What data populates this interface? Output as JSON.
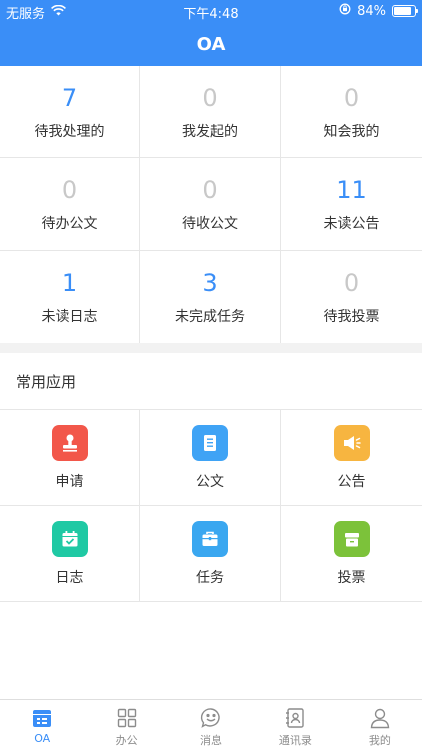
{
  "status_bar": {
    "carrier": "无服务",
    "time": "下午4:48",
    "battery": "84%",
    "battery_fraction": 0.84
  },
  "header": {
    "title": "OA"
  },
  "stats": [
    {
      "count": "7",
      "label": "待我处理的",
      "highlight": true
    },
    {
      "count": "0",
      "label": "我发起的",
      "highlight": false
    },
    {
      "count": "0",
      "label": "知会我的",
      "highlight": false
    },
    {
      "count": "0",
      "label": "待办公文",
      "highlight": false
    },
    {
      "count": "0",
      "label": "待收公文",
      "highlight": false
    },
    {
      "count": "11",
      "label": "未读公告",
      "highlight": true
    },
    {
      "count": "1",
      "label": "未读日志",
      "highlight": true
    },
    {
      "count": "3",
      "label": "未完成任务",
      "highlight": true
    },
    {
      "count": "0",
      "label": "待我投票",
      "highlight": false
    }
  ],
  "apps_section": {
    "title": "常用应用"
  },
  "apps": [
    {
      "label": "申请",
      "icon": "stamp-icon",
      "color": "#f2574a"
    },
    {
      "label": "公文",
      "icon": "document-icon",
      "color": "#3fa3f5"
    },
    {
      "label": "公告",
      "icon": "megaphone-icon",
      "color": "#f7b540"
    },
    {
      "label": "日志",
      "icon": "calendar-icon",
      "color": "#1fc9a4"
    },
    {
      "label": "任务",
      "icon": "briefcase-icon",
      "color": "#3aa7f0"
    },
    {
      "label": "投票",
      "icon": "ballot-box-icon",
      "color": "#7cc23a"
    }
  ],
  "tabs": [
    {
      "label": "OA",
      "icon": "oa-icon",
      "active": true
    },
    {
      "label": "办公",
      "icon": "grid-icon",
      "active": false
    },
    {
      "label": "消息",
      "icon": "message-icon",
      "active": false
    },
    {
      "label": "通讯录",
      "icon": "contacts-icon",
      "active": false
    },
    {
      "label": "我的",
      "icon": "profile-icon",
      "active": false
    }
  ],
  "colors": {
    "accent": "#3a8ef7",
    "inactive_count": "#c8c8c8",
    "tab_inactive": "#8c8c8c"
  }
}
